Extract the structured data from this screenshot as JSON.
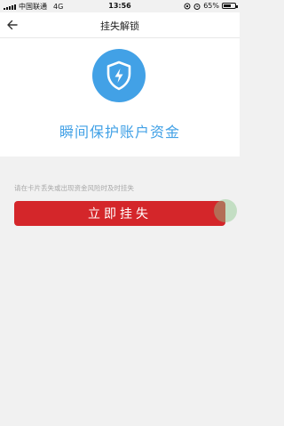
{
  "status_bar": {
    "carrier": "中国联通",
    "network": "4G",
    "time": "13:56",
    "battery": "65%",
    "battery_level": 0.65
  },
  "nav": {
    "title": "挂失解锁",
    "back_icon": "back-arrow-icon"
  },
  "hero": {
    "icon": "shield-lightning-icon",
    "text": "瞬间保护账户资金",
    "accent_color": "#42a1e6"
  },
  "hint": "请在卡片丢失或出现资金风险时及时挂失",
  "action": {
    "label": "立即挂失",
    "color": "#d4262a"
  }
}
